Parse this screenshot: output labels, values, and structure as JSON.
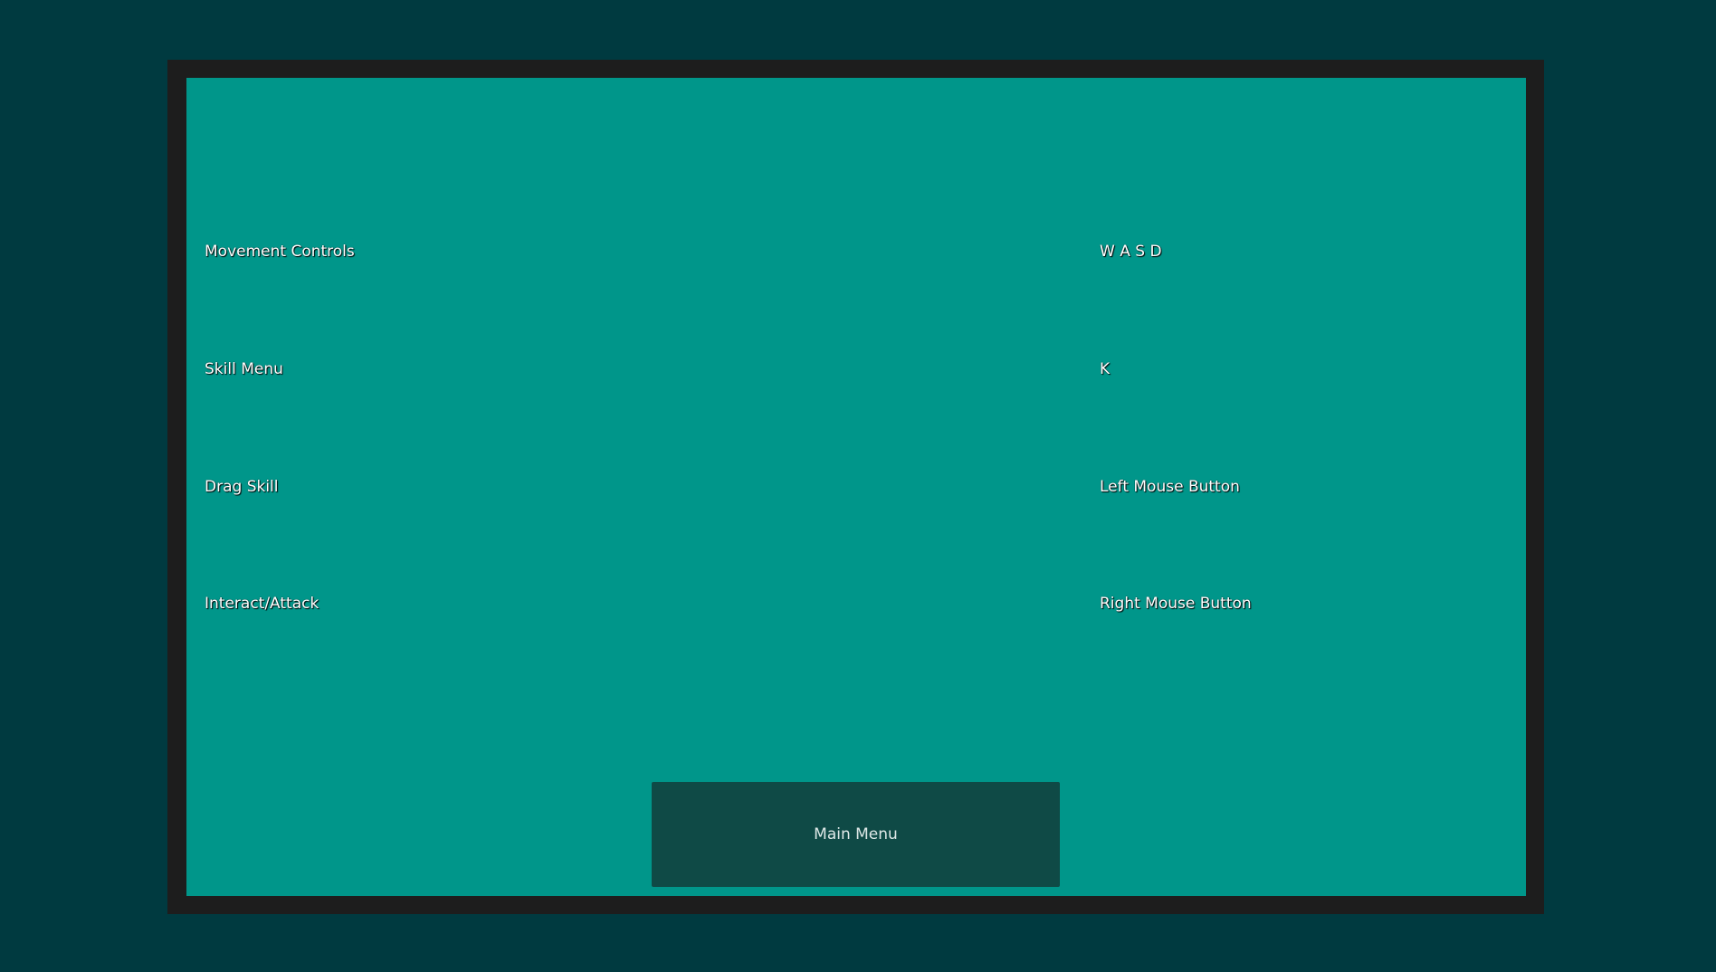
{
  "controls": [
    {
      "action": "Movement Controls",
      "binding": "W A S D"
    },
    {
      "action": "Skill Menu",
      "binding": "K"
    },
    {
      "action": "Drag Skill",
      "binding": "Left Mouse Button"
    },
    {
      "action": "Interact/Attack",
      "binding": "Right Mouse Button"
    }
  ],
  "main_menu_button": {
    "label": "Main Menu"
  },
  "colors": {
    "background": "#003a40",
    "frame": "#1d1d1d",
    "panel": "#00968a",
    "button": "#0f4a46"
  }
}
